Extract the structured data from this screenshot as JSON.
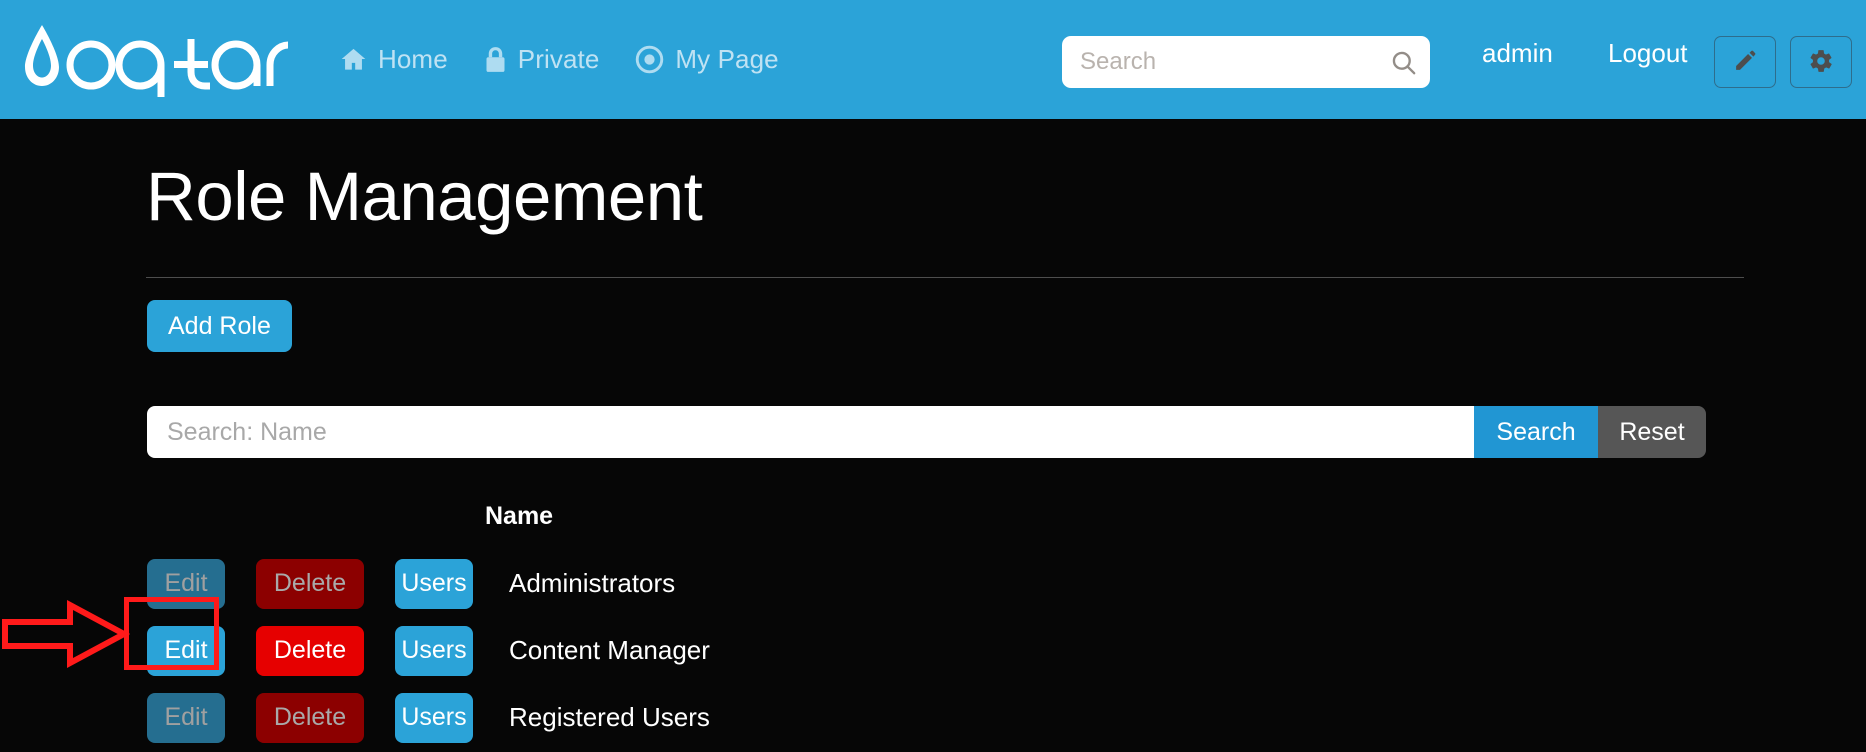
{
  "header": {
    "logo_text": "oqtane",
    "logo_icon": "water-droplet-icon",
    "nav": [
      {
        "label": "Home",
        "icon": "home-icon"
      },
      {
        "label": "Private",
        "icon": "lock-icon"
      },
      {
        "label": "My Page",
        "icon": "target-circle-icon"
      }
    ],
    "search": {
      "placeholder": "Search",
      "value": "",
      "icon": "search-icon"
    },
    "user": "admin",
    "logout": "Logout",
    "edit_icon": "pencil-icon",
    "settings_icon": "gear-icon",
    "brand_color": "#2ba3d8",
    "nav_label_color": "#bfe2f3"
  },
  "main": {
    "title": "Role Management",
    "add_role_label": "Add Role",
    "filter": {
      "placeholder": "Search: Name",
      "value": "",
      "search_label": "Search",
      "reset_label": "Reset"
    },
    "table": {
      "columns": [
        "Name"
      ],
      "rows": [
        {
          "name": "Administrators",
          "edit_label": "Edit",
          "delete_label": "Delete",
          "users_label": "Users",
          "edit_enabled": false,
          "delete_enabled": false,
          "users_enabled": true
        },
        {
          "name": "Content Manager",
          "edit_label": "Edit",
          "delete_label": "Delete",
          "users_label": "Users",
          "edit_enabled": true,
          "delete_enabled": true,
          "users_enabled": true
        },
        {
          "name": "Registered Users",
          "edit_label": "Edit",
          "delete_label": "Delete",
          "users_label": "Users",
          "edit_enabled": false,
          "delete_enabled": false,
          "users_enabled": true
        }
      ]
    }
  },
  "annotation": {
    "color": "#ff1a1a",
    "target": "edit-button-content-manager",
    "shapes": [
      "arrow-right",
      "highlight-box"
    ]
  },
  "colors": {
    "background": "#060606",
    "accent": "#2ba3d8",
    "danger": "#e60000",
    "danger_disabled": "#8c0000",
    "accent_disabled": "#256e90",
    "reset_grey": "#565656"
  }
}
